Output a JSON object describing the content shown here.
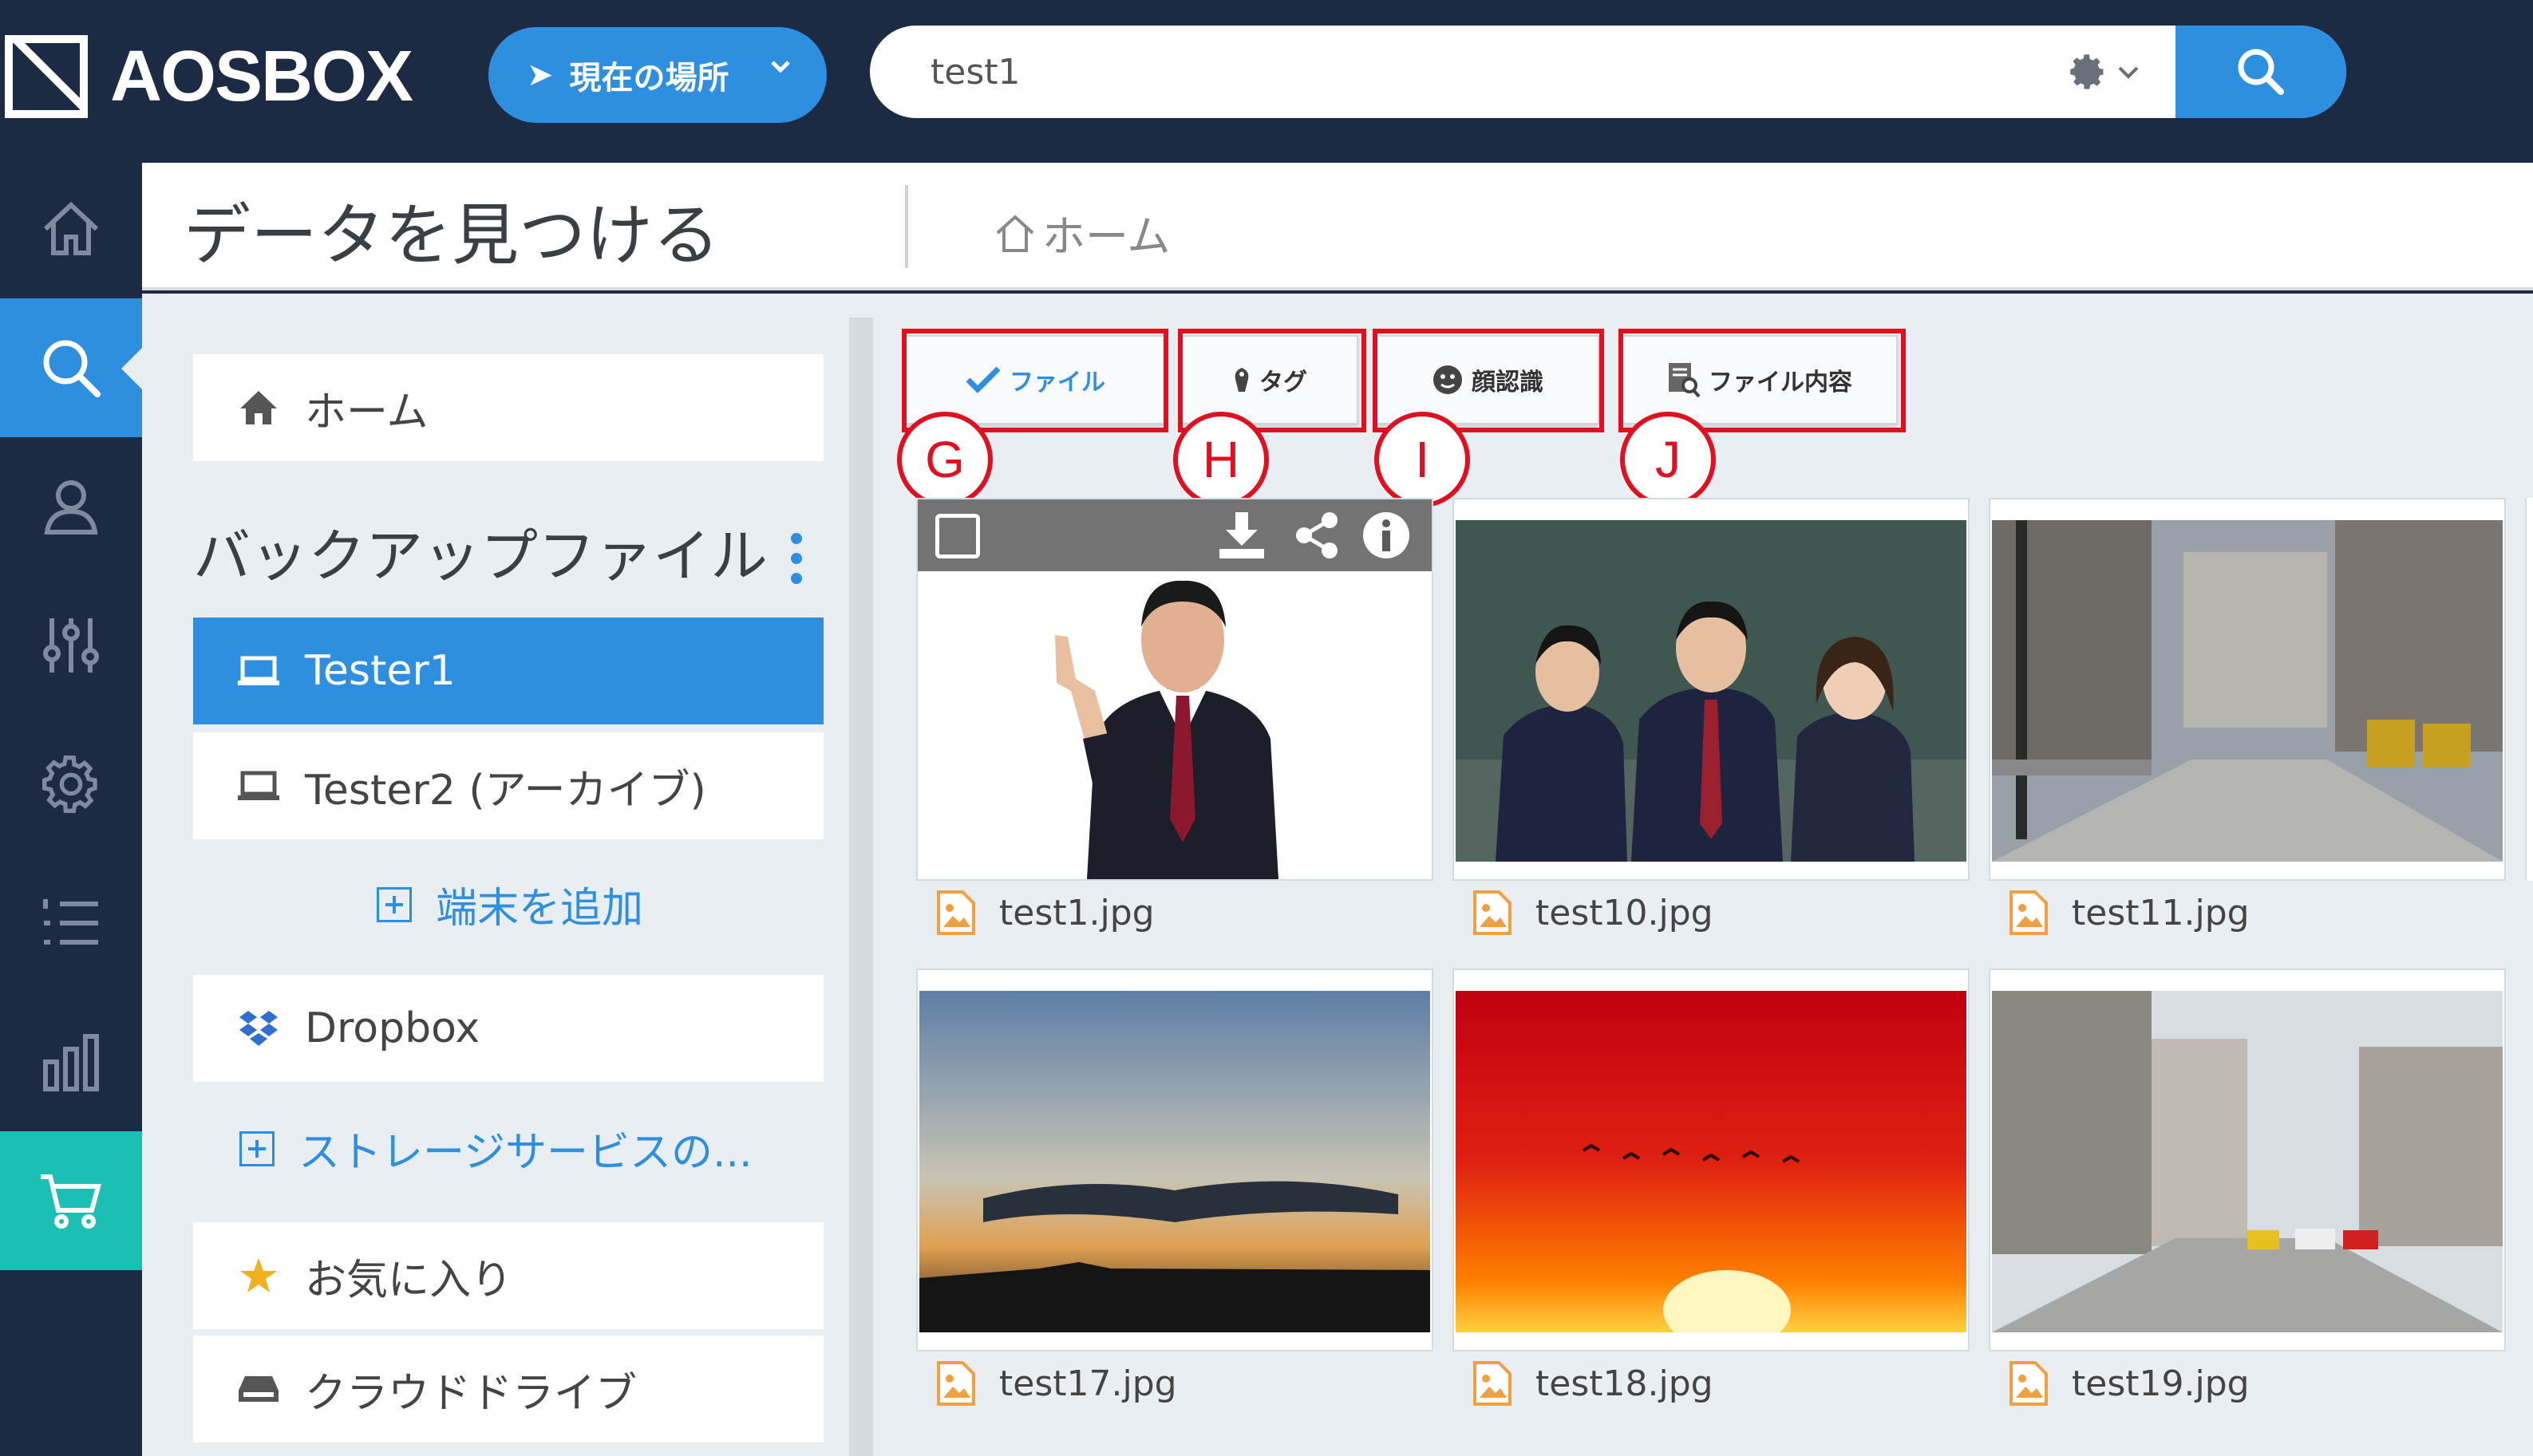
{
  "app": {
    "logo_text": "AOSBOX"
  },
  "topbar": {
    "location_button": "現在の場所",
    "search": {
      "value": "test1"
    }
  },
  "header": {
    "title": "データを見つける",
    "breadcrumb": "ホーム"
  },
  "sidebar": {
    "home": "ホーム",
    "section_title": "バックアップファイル",
    "devices": [
      {
        "label": "Tester1",
        "active": true
      },
      {
        "label": "Tester2 (アーカイブ)",
        "active": false
      }
    ],
    "add_device": "端末を追加",
    "dropbox": "Dropbox",
    "add_storage": "ストレージサービスの...",
    "favorites": "お気に入り",
    "cloud_drive": "クラウドドライブ"
  },
  "filters": {
    "tabs": [
      {
        "label": "ファイル",
        "active": true
      },
      {
        "label": "タグ",
        "active": false
      },
      {
        "label": "顔認識",
        "active": false
      },
      {
        "label": "ファイル内容",
        "active": false
      }
    ],
    "markers": [
      "G",
      "H",
      "I",
      "J"
    ]
  },
  "files": [
    {
      "name": "test1.jpg"
    },
    {
      "name": "test10.jpg"
    },
    {
      "name": "test11.jpg"
    },
    {
      "name": "test17.jpg"
    },
    {
      "name": "test18.jpg"
    },
    {
      "name": "test19.jpg"
    }
  ],
  "colors": {
    "accent": "#2e8fe0",
    "nav_bg": "#1c2a44",
    "cart": "#1bbfb3",
    "annotation": "#e01020",
    "file_icon": "#f0a040"
  }
}
